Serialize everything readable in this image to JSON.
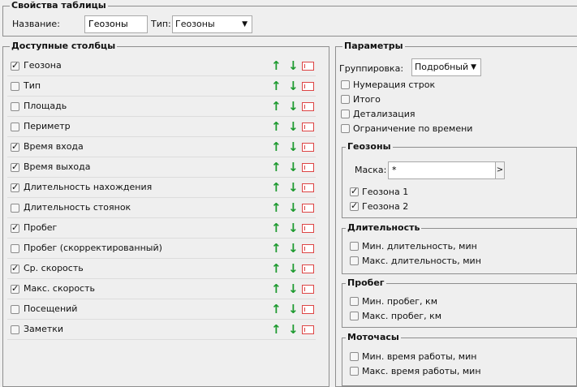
{
  "table_props": {
    "legend": "Свойства таблицы",
    "name_label": "Название:",
    "name_value": "Геозоны",
    "type_label": "Тип:",
    "type_value": "Геозоны"
  },
  "columns": {
    "legend": "Доступные столбцы",
    "items": [
      {
        "label": "Геозона",
        "checked": true
      },
      {
        "label": "Тип",
        "checked": false
      },
      {
        "label": "Площадь",
        "checked": false
      },
      {
        "label": "Периметр",
        "checked": false
      },
      {
        "label": "Время входа",
        "checked": true
      },
      {
        "label": "Время выхода",
        "checked": true
      },
      {
        "label": "Длительность нахождения",
        "checked": true
      },
      {
        "label": "Длительность стоянок",
        "checked": false
      },
      {
        "label": "Пробег",
        "checked": true
      },
      {
        "label": "Пробег (скорректированный)",
        "checked": false
      },
      {
        "label": "Ср. скорость",
        "checked": true
      },
      {
        "label": "Макс. скорость",
        "checked": true
      },
      {
        "label": "Посещений",
        "checked": false
      },
      {
        "label": "Заметки",
        "checked": false
      }
    ],
    "icons": {
      "up": "arrow-up-icon",
      "down": "arrow-down-icon",
      "delete": "delete-icon"
    },
    "colors": {
      "arrow": "#1d9a2f",
      "delete": "#dd4444"
    }
  },
  "params": {
    "legend": "Параметры",
    "grouping_label": "Группировка:",
    "grouping_value": "Подробный",
    "options": [
      {
        "label": "Нумерация строк",
        "checked": false
      },
      {
        "label": "Итого",
        "checked": false
      },
      {
        "label": "Детализация",
        "checked": false
      },
      {
        "label": "Ограничение по времени",
        "checked": false
      }
    ],
    "geozones": {
      "legend": "Геозоны",
      "mask_label": "Маска:",
      "mask_value": "*",
      "mask_button": ">",
      "items": [
        {
          "label": "Геозона 1",
          "checked": true
        },
        {
          "label": "Геозона 2",
          "checked": true
        }
      ]
    },
    "duration": {
      "legend": "Длительность",
      "items": [
        {
          "label": "Мин. длительность, мин",
          "checked": false
        },
        {
          "label": "Макс. длительность, мин",
          "checked": false
        }
      ]
    },
    "mileage": {
      "legend": "Пробег",
      "items": [
        {
          "label": "Мин. пробег, км",
          "checked": false
        },
        {
          "label": "Макс. пробег, км",
          "checked": false
        }
      ]
    },
    "engine_hours": {
      "legend": "Моточасы",
      "items": [
        {
          "label": "Мин. время работы, мин",
          "checked": false
        },
        {
          "label": "Макс. время работы, мин",
          "checked": false
        }
      ]
    }
  }
}
